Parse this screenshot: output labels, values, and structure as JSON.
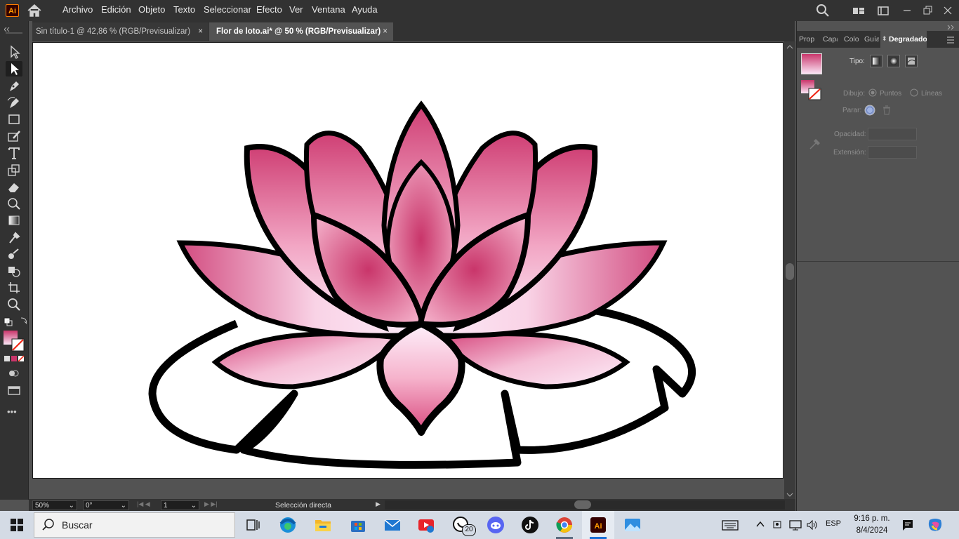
{
  "app": {
    "logo_text": "Ai",
    "menu": [
      "Archivo",
      "Edición",
      "Objeto",
      "Texto",
      "Seleccionar",
      "Efecto",
      "Ver",
      "Ventana",
      "Ayuda"
    ]
  },
  "tabs": [
    {
      "label": "Sin título-1 @ 42,86 % (RGB/Previsualizar)",
      "close": "×",
      "active": false
    },
    {
      "label": "Flor de loto.ai* @ 50 % (RGB/Previsualizar)",
      "close": "×",
      "active": true
    }
  ],
  "tools": [
    "selection-tool",
    "direct-selection-tool",
    "pen-tool",
    "curvature-tool",
    "rectangle-tool",
    "paintbrush-tool",
    "type-tool",
    "scale-tool",
    "eraser-tool",
    "warp-tool",
    "gradient-tool",
    "eyedropper-tool",
    "blend-tool",
    "shape-builder-tool",
    "artboard-tool",
    "zoom-tool"
  ],
  "status": {
    "zoom": "50%",
    "rotation": "0°",
    "artboard_number": "1",
    "current_tool": "Selección directa"
  },
  "panel": {
    "tabs": [
      "Prop",
      "Capa",
      "Colo",
      "Guía",
      "Degradado"
    ],
    "active_tab": "Degradado",
    "type_label": "Tipo:",
    "stroke_label": "Dibujo:",
    "stroke_option_points": "Puntos",
    "stroke_option_lines": "Líneas",
    "stop_label": "Parar:",
    "opacity_label": "Opacidad:",
    "extension_label": "Extensión:"
  },
  "taskbar": {
    "search_placeholder": "Buscar",
    "whatsapp_badge": "20",
    "language": "ESP",
    "time": "9:16 p. m.",
    "date": "8/4/2024"
  },
  "colors": {
    "petal_dark": "#c9356a",
    "petal_mid": "#e87aa3",
    "petal_light": "#fbe7f7",
    "accent_orange": "#ff7c00"
  }
}
